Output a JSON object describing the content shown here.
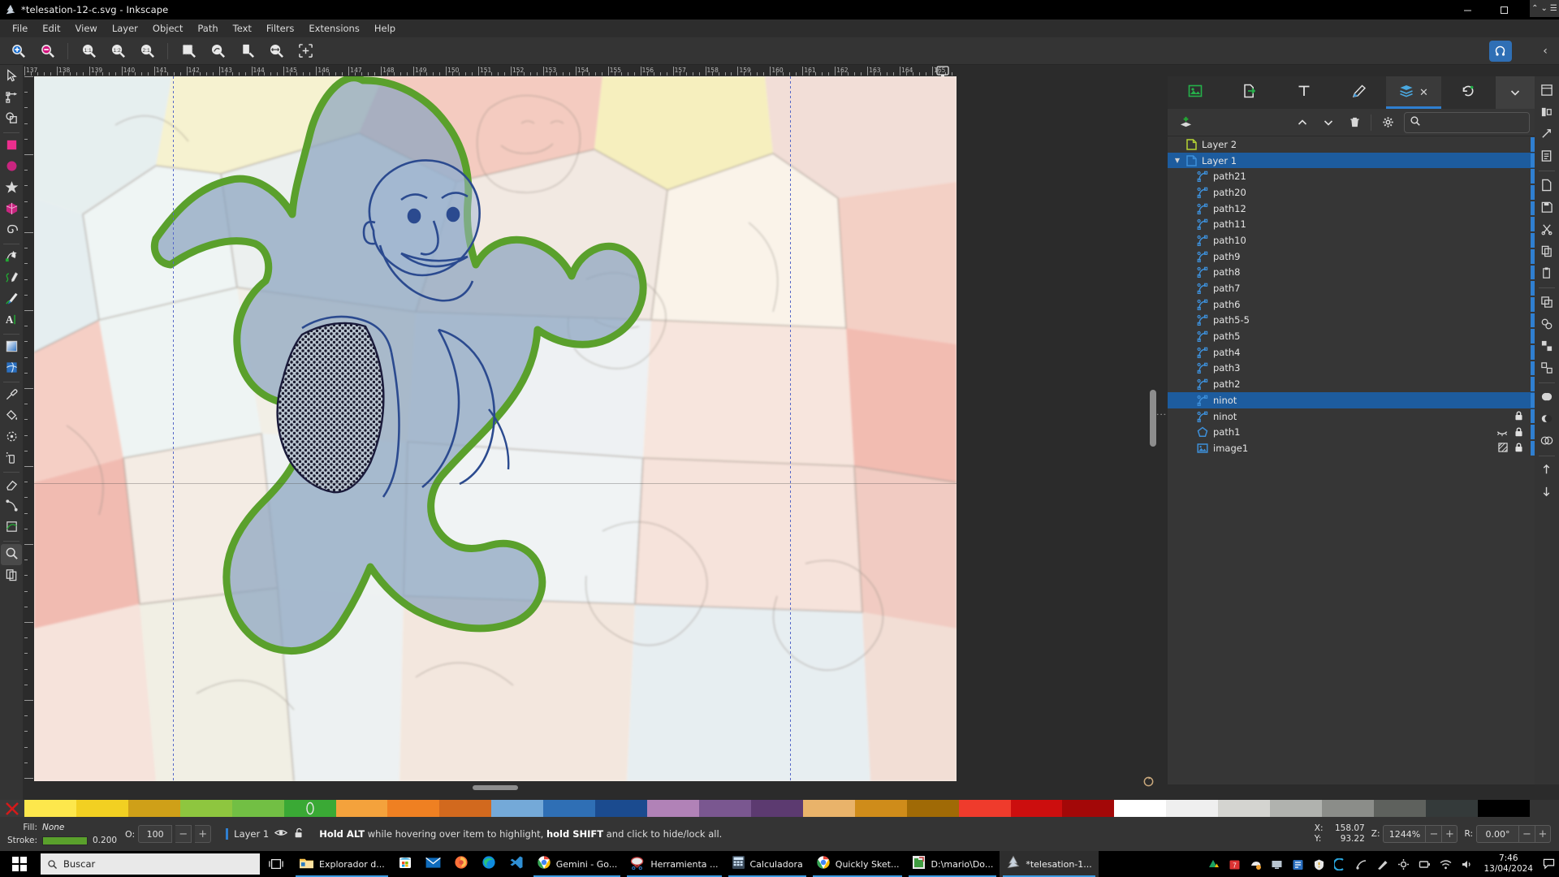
{
  "window": {
    "title": "*telesation-12-c.svg - Inkscape",
    "app_icon": "inkscape-logo-icon",
    "minimize": "minimize-icon",
    "maximize": "maximize-icon",
    "close": "close-icon"
  },
  "menu": {
    "items": [
      "File",
      "Edit",
      "View",
      "Layer",
      "Object",
      "Path",
      "Text",
      "Filters",
      "Extensions",
      "Help"
    ]
  },
  "command_bar": {
    "buttons": [
      {
        "name": "zoom-in-icon",
        "label": "Zoom In"
      },
      {
        "name": "zoom-out-icon",
        "label": "Zoom Out"
      },
      {
        "name": "zoom-1-1-icon",
        "label": "1:1"
      },
      {
        "name": "zoom-1-2-icon",
        "label": "1:2"
      },
      {
        "name": "zoom-2-1-icon",
        "label": "2:1"
      },
      {
        "name": "zoom-selection-icon",
        "label": "Zoom Selection"
      },
      {
        "name": "zoom-drawing-icon",
        "label": "Zoom Drawing"
      },
      {
        "name": "zoom-page-icon",
        "label": "Zoom Page"
      },
      {
        "name": "zoom-page-width-icon",
        "label": "Zoom Page Width"
      },
      {
        "name": "zoom-center-page-icon",
        "label": "Center Page"
      }
    ],
    "snap_toggle": "snap-controls-icon",
    "collapse": "chevron-left-icon"
  },
  "toolbox": {
    "tools": [
      {
        "name": "selector-tool",
        "icon": "arrow-cursor-icon",
        "active": false
      },
      {
        "name": "node-tool",
        "icon": "node-editor-icon",
        "active": false
      },
      {
        "name": "shape-builder-tool",
        "icon": "shape-builder-icon",
        "active": false
      },
      {
        "name": "rectangle-tool",
        "icon": "square-icon",
        "active": false
      },
      {
        "name": "ellipse-tool",
        "icon": "circle-icon",
        "active": false
      },
      {
        "name": "star-tool",
        "icon": "star-icon",
        "active": false
      },
      {
        "name": "box3d-tool",
        "icon": "cube-icon",
        "active": false
      },
      {
        "name": "spiral-tool",
        "icon": "spiral-icon",
        "active": false
      },
      {
        "name": "pen-tool",
        "icon": "bezier-pen-icon",
        "active": false
      },
      {
        "name": "pencil-tool",
        "icon": "pencil-icon",
        "active": false
      },
      {
        "name": "calligraphy-tool",
        "icon": "calligraphy-brush-icon",
        "active": false
      },
      {
        "name": "text-tool",
        "icon": "text-A-icon",
        "active": false
      },
      {
        "name": "gradient-tool",
        "icon": "gradient-icon",
        "active": false
      },
      {
        "name": "mesh-gradient-tool",
        "icon": "mesh-gradient-icon",
        "active": false
      },
      {
        "name": "dropper-tool",
        "icon": "eyedropper-icon",
        "active": false
      },
      {
        "name": "paint-bucket-tool",
        "icon": "paint-bucket-icon",
        "active": false
      },
      {
        "name": "tweak-tool",
        "icon": "tweak-icon",
        "active": false
      },
      {
        "name": "spray-tool",
        "icon": "spray-can-icon",
        "active": false
      },
      {
        "name": "eraser-tool",
        "icon": "eraser-icon",
        "active": false
      },
      {
        "name": "connector-tool",
        "icon": "connector-icon",
        "active": false
      },
      {
        "name": "lpe-tool",
        "icon": "lpe-icon",
        "active": false
      },
      {
        "name": "measure-tool",
        "icon": "measure-magnifier-icon",
        "active": true
      },
      {
        "name": "pages-tool",
        "icon": "pages-icon",
        "active": false
      }
    ]
  },
  "rulers": {
    "horizontal_labels": [
      "137",
      "138",
      "139",
      "140",
      "141",
      "142",
      "143",
      "144",
      "145",
      "146",
      "147",
      "148",
      "149",
      "150",
      "151",
      "152",
      "153",
      "154",
      "155",
      "156",
      "157",
      "158",
      "159",
      "160",
      "161",
      "162",
      "163",
      "164",
      "165"
    ],
    "vertical_visible": true
  },
  "canvas": {
    "zoom_display": "1244%",
    "screen_icon": "display-monitor-icon",
    "rotate_icon": "canvas-rotate-icon",
    "hscroll": "horizontal-scrollbar",
    "vscroll": "vertical-scrollbar"
  },
  "dock": {
    "tabs": [
      {
        "name": "tab-xml-editor",
        "icon": "image-properties-icon",
        "active": false
      },
      {
        "name": "tab-export",
        "icon": "export-icon",
        "active": false
      },
      {
        "name": "tab-text-and-font",
        "icon": "text-T-icon",
        "active": false
      },
      {
        "name": "tab-fill-and-stroke",
        "icon": "fill-stroke-brush-icon",
        "active": false
      },
      {
        "name": "tab-objects",
        "icon": "objects-layers-icon",
        "active": true,
        "close": "close-icon"
      },
      {
        "name": "tab-undo-history",
        "icon": "undo-history-icon",
        "active": false
      }
    ],
    "tab_overflow": "chevron-down-icon",
    "toolbar": {
      "add_layer": "add-layer-icon",
      "move_up": "chevron-up-icon",
      "move_down": "chevron-down-icon",
      "delete": "trash-icon",
      "settings": "gear-icon",
      "search_icon": "search-icon",
      "search_value": "",
      "search_placeholder": ""
    },
    "layers": [
      {
        "label": "Layer 2",
        "icon": "layer-icon",
        "icon_color": "#b5d334",
        "indent": 0,
        "selected": false,
        "expander": "",
        "stripe": true,
        "hidden": false,
        "locked": false,
        "clip": false
      },
      {
        "label": "Layer 1",
        "icon": "layer-icon",
        "icon_color": "#3d8fd9",
        "indent": 0,
        "selected": true,
        "expander": "down",
        "stripe": true,
        "hidden": false,
        "locked": false,
        "clip": false
      },
      {
        "label": "path21",
        "icon": "path-node-icon",
        "icon_color": "#3d8fd9",
        "indent": 1,
        "selected": false,
        "expander": "",
        "stripe": true,
        "hidden": false,
        "locked": false,
        "clip": false
      },
      {
        "label": "path20",
        "icon": "path-node-icon",
        "icon_color": "#3d8fd9",
        "indent": 1,
        "selected": false,
        "expander": "",
        "stripe": true,
        "hidden": false,
        "locked": false,
        "clip": false
      },
      {
        "label": "path12",
        "icon": "path-node-icon",
        "icon_color": "#3d8fd9",
        "indent": 1,
        "selected": false,
        "expander": "",
        "stripe": true,
        "hidden": false,
        "locked": false,
        "clip": false
      },
      {
        "label": "path11",
        "icon": "path-node-icon",
        "icon_color": "#3d8fd9",
        "indent": 1,
        "selected": false,
        "expander": "",
        "stripe": true,
        "hidden": false,
        "locked": false,
        "clip": false
      },
      {
        "label": "path10",
        "icon": "path-node-icon",
        "icon_color": "#3d8fd9",
        "indent": 1,
        "selected": false,
        "expander": "",
        "stripe": true,
        "hidden": false,
        "locked": false,
        "clip": false
      },
      {
        "label": "path9",
        "icon": "path-node-icon",
        "icon_color": "#3d8fd9",
        "indent": 1,
        "selected": false,
        "expander": "",
        "stripe": true,
        "hidden": false,
        "locked": false,
        "clip": false
      },
      {
        "label": "path8",
        "icon": "path-node-icon",
        "icon_color": "#3d8fd9",
        "indent": 1,
        "selected": false,
        "expander": "",
        "stripe": true,
        "hidden": false,
        "locked": false,
        "clip": false
      },
      {
        "label": "path7",
        "icon": "path-node-icon",
        "icon_color": "#3d8fd9",
        "indent": 1,
        "selected": false,
        "expander": "",
        "stripe": true,
        "hidden": false,
        "locked": false,
        "clip": false
      },
      {
        "label": "path6",
        "icon": "path-node-icon",
        "icon_color": "#3d8fd9",
        "indent": 1,
        "selected": false,
        "expander": "",
        "stripe": true,
        "hidden": false,
        "locked": false,
        "clip": false
      },
      {
        "label": "path5-5",
        "icon": "path-node-icon",
        "icon_color": "#3d8fd9",
        "indent": 1,
        "selected": false,
        "expander": "",
        "stripe": true,
        "hidden": false,
        "locked": false,
        "clip": false
      },
      {
        "label": "path5",
        "icon": "path-node-icon",
        "icon_color": "#3d8fd9",
        "indent": 1,
        "selected": false,
        "expander": "",
        "stripe": true,
        "hidden": false,
        "locked": false,
        "clip": false
      },
      {
        "label": "path4",
        "icon": "path-node-icon",
        "icon_color": "#3d8fd9",
        "indent": 1,
        "selected": false,
        "expander": "",
        "stripe": true,
        "hidden": false,
        "locked": false,
        "clip": false
      },
      {
        "label": "path3",
        "icon": "path-node-icon",
        "icon_color": "#3d8fd9",
        "indent": 1,
        "selected": false,
        "expander": "",
        "stripe": true,
        "hidden": false,
        "locked": false,
        "clip": false
      },
      {
        "label": "path2",
        "icon": "path-node-icon",
        "icon_color": "#3d8fd9",
        "indent": 1,
        "selected": false,
        "expander": "",
        "stripe": true,
        "hidden": false,
        "locked": false,
        "clip": false
      },
      {
        "label": "ninot",
        "icon": "path-node-icon",
        "icon_color": "#3d8fd9",
        "indent": 1,
        "selected": true,
        "expander": "",
        "stripe": true,
        "hidden": false,
        "locked": false,
        "clip": false
      },
      {
        "label": "ninot",
        "icon": "path-node-icon",
        "icon_color": "#3d8fd9",
        "indent": 1,
        "selected": false,
        "expander": "",
        "stripe": true,
        "hidden": false,
        "locked": true,
        "clip": false
      },
      {
        "label": "path1",
        "icon": "polygon-icon",
        "icon_color": "#3d8fd9",
        "indent": 1,
        "selected": false,
        "expander": "",
        "stripe": true,
        "hidden": true,
        "locked": true,
        "clip": false
      },
      {
        "label": "image1",
        "icon": "image-icon",
        "icon_color": "#3d8fd9",
        "indent": 1,
        "selected": false,
        "expander": "",
        "stripe": true,
        "hidden": false,
        "locked": true,
        "clip": true
      }
    ]
  },
  "rail": {
    "buttons": [
      {
        "name": "rail-document-properties-icon"
      },
      {
        "name": "rail-align-icon"
      },
      {
        "name": "rail-transform-icon"
      },
      {
        "name": "rail-document-resources-icon"
      },
      {
        "name": "rail-new-document-icon"
      },
      {
        "name": "rail-save-icon"
      },
      {
        "name": "rail-cut-icon"
      },
      {
        "name": "rail-copy-icon"
      },
      {
        "name": "rail-paste-icon"
      },
      {
        "name": "rail-duplicate-icon"
      },
      {
        "name": "rail-clone-icon"
      },
      {
        "name": "rail-group-icon"
      },
      {
        "name": "rail-ungroup-icon"
      },
      {
        "name": "rail-union-icon"
      },
      {
        "name": "rail-difference-icon"
      },
      {
        "name": "rail-intersection-icon"
      },
      {
        "name": "rail-raise-icon"
      },
      {
        "name": "rail-lower-icon"
      }
    ]
  },
  "palette": {
    "x_icon": "no-color-x-icon",
    "colors": [
      "#fde74c",
      "#f2d022",
      "#cfa018",
      "#8ec63f",
      "#72bf44",
      "#3aa935",
      "#f4a23c",
      "#ef8022",
      "#d2691e",
      "#74a9d8",
      "#2f6fb5",
      "#1b4b8f",
      "#b182b7",
      "#7a5790",
      "#5c3a70",
      "#e9b36a",
      "#cf8c1a",
      "#a06a06",
      "#ef3b2c",
      "#cc0e0e",
      "#a30808",
      "#ffffff",
      "#efefef",
      "#d4d4d0",
      "#b0b2ae",
      "#8b8d89",
      "#5e615d",
      "#343a3a",
      "#000000"
    ],
    "up_arrow": "chevron-up-icon",
    "down_arrow": "chevron-down-icon"
  },
  "status": {
    "fill_label": "Fill:",
    "fill_value": "None",
    "stroke_label": "Stroke:",
    "stroke_color": "#5aa02c",
    "stroke_width": "0.200",
    "opacity_label": "O:",
    "opacity_value": "100",
    "opacity_minus": "minus-icon",
    "opacity_plus": "plus-icon",
    "layer_name": "Layer 1",
    "layer_visibility_icon": "eye-icon",
    "layer_lock_icon": "unlocked-padlock-icon",
    "message_pre": "Hold ALT",
    "message_mid": " while hovering over item to highlight, ",
    "message_bold2": "hold SHIFT",
    "message_post": " and click to hide/lock all.",
    "x_label": "X:",
    "x_value": "158.07",
    "y_label": "Y:",
    "y_value": "93.22",
    "zoom_label": "Z:",
    "zoom_value": "1244%",
    "zoom_minus": "minus-icon",
    "zoom_plus": "plus-icon",
    "rotation_label": "R:",
    "rotation_value": "0.00°",
    "rotation_minus": "minus-icon",
    "rotation_plus": "plus-icon"
  },
  "taskbar": {
    "start_icon": "windows-start-icon",
    "search_icon": "search-icon",
    "search_placeholder": "Buscar",
    "task_view_icon": "task-view-icon",
    "apps": [
      {
        "label": "Explorador d...",
        "icon": "file-explorer-icon",
        "active": true,
        "show_label": true
      },
      {
        "label": "",
        "icon": "microsoft-store-icon",
        "active": false,
        "show_label": false
      },
      {
        "label": "",
        "icon": "mail-icon",
        "active": false,
        "show_label": false
      },
      {
        "label": "",
        "icon": "firefox-icon",
        "active": false,
        "show_label": false
      },
      {
        "label": "",
        "icon": "edge-icon",
        "active": false,
        "show_label": false
      },
      {
        "label": "",
        "icon": "vscode-icon",
        "active": false,
        "show_label": false
      },
      {
        "label": "Gemini - Go...",
        "icon": "chrome-icon",
        "active": true,
        "show_label": true
      },
      {
        "label": "Herramienta ...",
        "icon": "snipping-tool-icon",
        "active": true,
        "show_label": true
      },
      {
        "label": "Calculadora",
        "icon": "calculator-icon",
        "active": true,
        "show_label": true
      },
      {
        "label": "Quickly Sket...",
        "icon": "chrome-icon",
        "active": true,
        "show_label": true
      },
      {
        "label": "D:\\mario\\Do...",
        "icon": "folder-window-icon",
        "active": true,
        "show_label": true
      },
      {
        "label": "*telesation-1...",
        "icon": "inkscape-icon",
        "active": true,
        "show_label": true,
        "focused": true
      }
    ],
    "tray": [
      {
        "name": "google-drive-tray-icon"
      },
      {
        "name": "calendar-tray-icon"
      },
      {
        "name": "onedrive-tray-icon"
      },
      {
        "name": "display-tray-icon"
      },
      {
        "name": "app-tray-icon"
      },
      {
        "name": "security-tray-icon"
      },
      {
        "name": "phone-link-tray-icon"
      },
      {
        "name": "satellite-tray-icon"
      },
      {
        "name": "pen-tray-icon"
      },
      {
        "name": "settings-tray-icon"
      },
      {
        "name": "battery-tray-icon"
      },
      {
        "name": "network-tray-icon"
      },
      {
        "name": "volume-tray-icon"
      }
    ],
    "clock_time": "7:46",
    "clock_date": "13/04/2024",
    "notification_icon": "notification-icon"
  }
}
